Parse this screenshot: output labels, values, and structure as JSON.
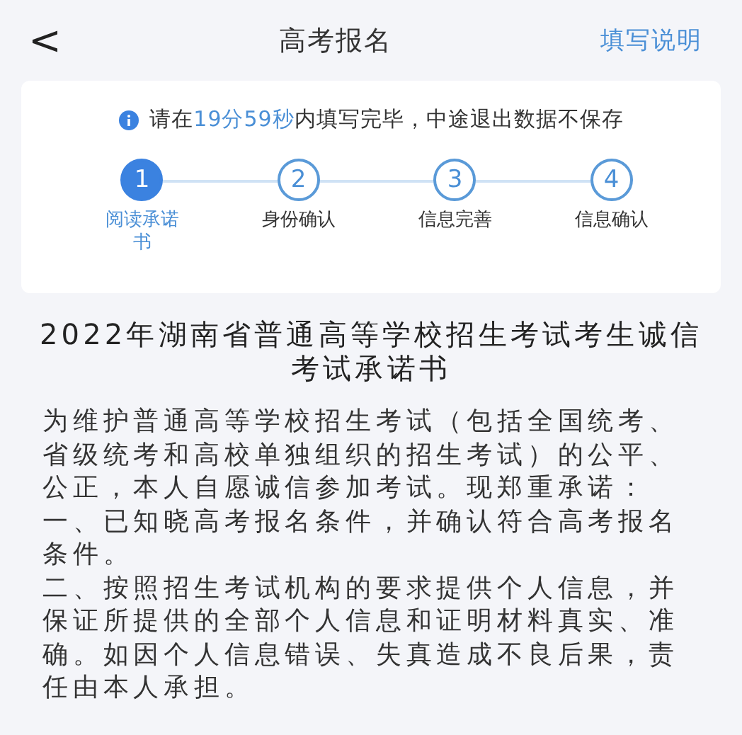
{
  "header": {
    "back": "<",
    "title": "高考报名",
    "action": "填写说明"
  },
  "notice": {
    "highlight": "19分59秒",
    "before": "请在",
    "after": "内填写完毕，中途退出数据不保存"
  },
  "steps": [
    {
      "number": "1",
      "label": "阅读承诺书",
      "selected": true
    },
    {
      "number": "2",
      "label": "身份确认",
      "selected": false
    },
    {
      "number": "3",
      "label": "信息完善",
      "selected": false
    },
    {
      "number": "4",
      "label": "信息确认",
      "selected": false
    }
  ],
  "document": {
    "title": "2022年湖南省普通高等学校招生考试考生诚信考试承诺书",
    "paragraphs": [
      "为维护普通高等学校招生考试（包括全国统考、省级统考和高校单独组织的招生考试）的公平、公正，本人自愿诚信参加考试。现郑重承诺：",
      "一、已知晓高考报名条件，并确认符合高考报名条件。",
      "二、按照招生考试机构的要求提供个人信息，并保证所提供的全部个人信息和证明材料真实、准确。如因个人信息错误、失真造成不良后果，责任由本人承担。"
    ]
  }
}
